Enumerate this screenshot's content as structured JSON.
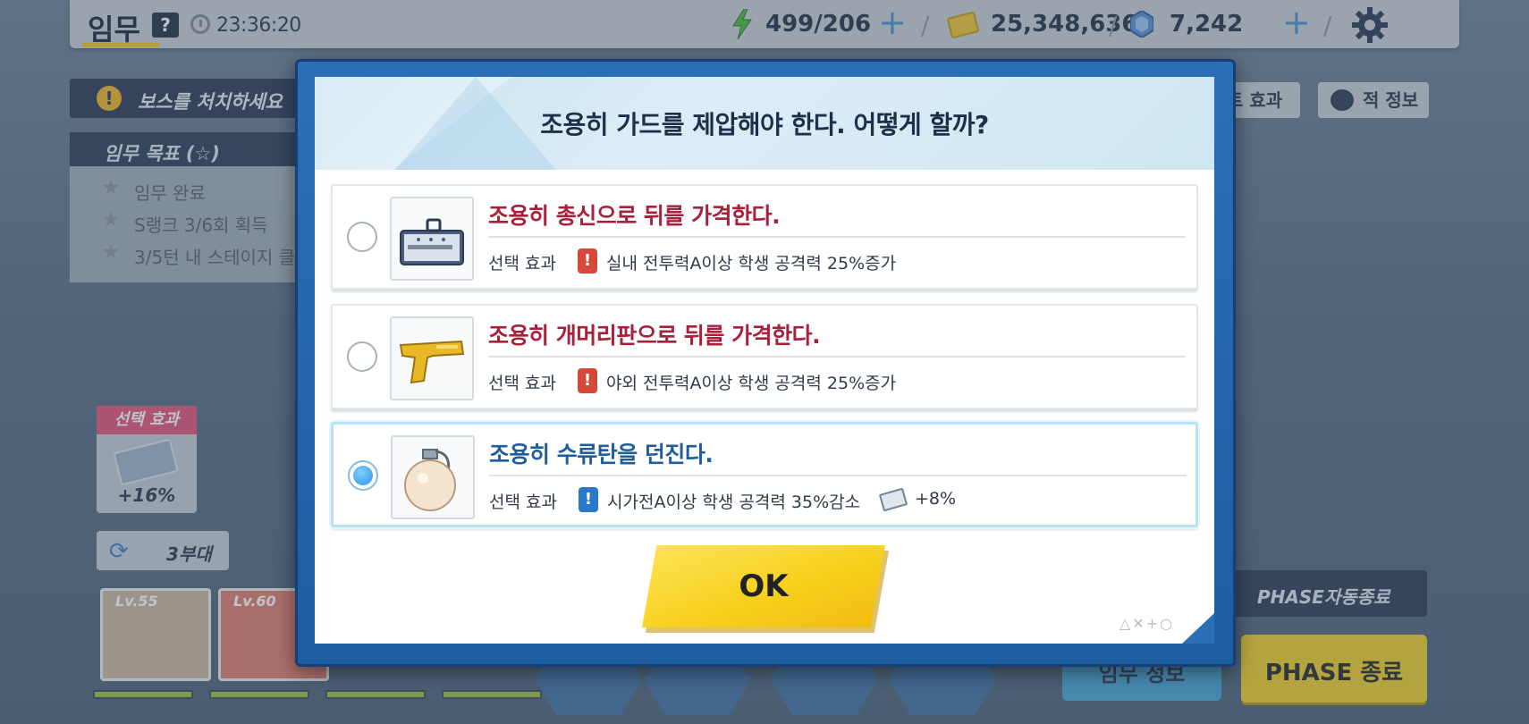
{
  "topbar": {
    "title": "임무",
    "help": "?",
    "timer": "23:36:20",
    "ap": "499/206",
    "credits": "25,348,636",
    "gems": "7,242",
    "plus": "+",
    "sep": "/"
  },
  "left_panel": {
    "boss_banner": "보스를 처치하세요",
    "objectives_header": "임무 목표 (☆)",
    "objectives": [
      "임무 완료",
      "S랭크 3/6회 획득",
      "3/5턴 내 스테이지 클"
    ],
    "selection_effect_header": "선택 효과",
    "selection_effect_value": "+16%",
    "squad_label": "3부대"
  },
  "right_tabs": {
    "set_effect": "트 효과",
    "enemy_info": "적 정보"
  },
  "bottom": {
    "phase_auto": "PHASE자동종료",
    "phase_end": "PHASE 종료",
    "mission_info": "임무 정보",
    "portraits": [
      {
        "level": "Lv.55",
        "color": "#cbb79e"
      },
      {
        "level": "Lv.60",
        "color": "#e07f6f"
      }
    ]
  },
  "dialog": {
    "title": "조용히 가드를 제압해야 한다. 어떻게 할까?",
    "effect_label": "선택 효과",
    "options": [
      {
        "title": "조용히 총신으로 뒤를 가격한다.",
        "effect": "실내 전투력A이상 학생 공격력 25%증가",
        "badge": "!",
        "bonus": "",
        "selected": false
      },
      {
        "title": "조용히 개머리판으로 뒤를 가격한다.",
        "effect": "야외 전투력A이상 학생 공격력 25%증가",
        "badge": "!",
        "bonus": "",
        "selected": false
      },
      {
        "title": "조용히 수류탄을 던진다.",
        "effect": "시가전A이상 학생 공격력 35%감소",
        "badge": "!",
        "bonus": "+8%",
        "selected": true
      }
    ],
    "ok_label": "OK",
    "deco": "△✕+○"
  },
  "colors": {
    "accent_yellow": "#f7d11e",
    "frame_blue": "#2a6fb8",
    "title_red": "#a8203a",
    "title_blue": "#1f5d9c"
  }
}
